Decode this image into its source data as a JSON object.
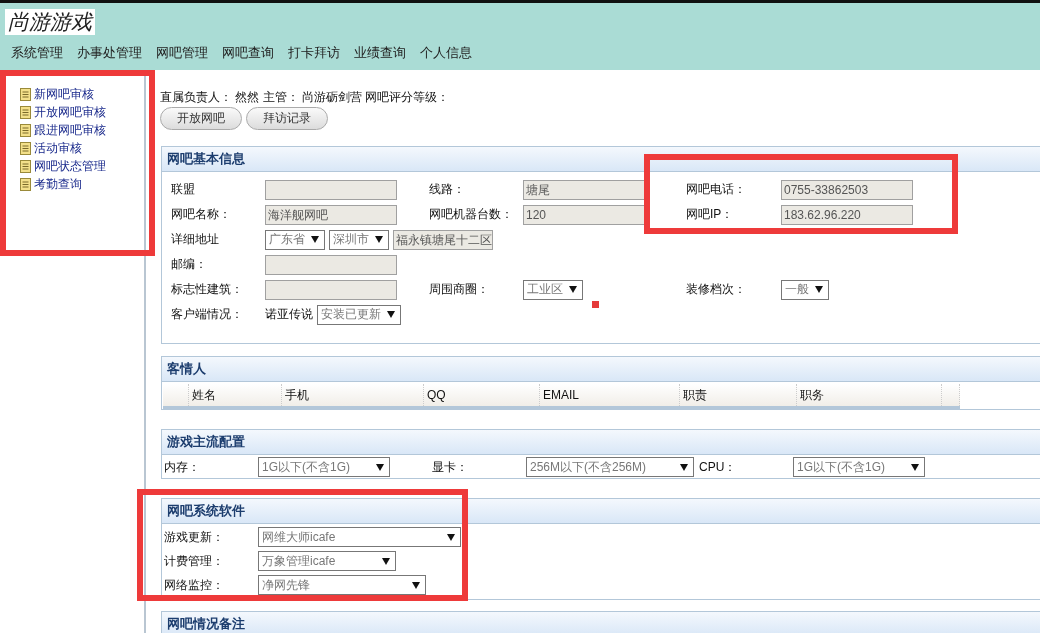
{
  "logo": "尚游游戏",
  "menu": [
    "系统管理",
    "办事处管理",
    "网吧管理",
    "网吧查询",
    "打卡拜访",
    "业绩查询",
    "个人信息"
  ],
  "sidebar": {
    "items": [
      "新网吧审核",
      "开放网吧审核",
      "跟进网吧审核",
      "活动审核",
      "网吧状态管理",
      "考勤查询"
    ]
  },
  "summary": "直属负责人： 然然 主管： 尚游砺剑营 网吧评分等级：",
  "buttons": [
    "开放网吧",
    "拜访记录"
  ],
  "basic_info": {
    "title": "网吧基本信息",
    "rows": [
      {
        "kind": "plain",
        "cells": [
          {
            "label": "联盟",
            "controls": [
              {
                "kind": "input"
              }
            ]
          },
          {
            "label": "线路：",
            "controls": [
              {
                "kind": "input",
                "value": "塘尾"
              }
            ]
          },
          {
            "label": "网吧电话：",
            "controls": [
              {
                "kind": "input",
                "value": "0755-33862503"
              }
            ]
          }
        ]
      },
      {
        "kind": "plain",
        "cells": [
          {
            "label": "网吧名称：",
            "controls": [
              {
                "kind": "input",
                "value": "海洋舰网吧"
              }
            ]
          },
          {
            "label": "网吧机器台数：",
            "controls": [
              {
                "kind": "input",
                "value": "120"
              }
            ]
          },
          {
            "label": "网吧IP：",
            "controls": [
              {
                "kind": "input",
                "value": "183.62.96.220"
              }
            ]
          }
        ]
      },
      {
        "kind": "address",
        "cells": [
          {
            "label": "详细地址",
            "controls": [
              {
                "kind": "select",
                "value": "广东省"
              },
              {
                "kind": "select",
                "value": "深圳市"
              },
              {
                "kind": "input",
                "value": "福永镇塘尾十二区"
              }
            ]
          }
        ]
      },
      {
        "kind": "plain",
        "cells": [
          {
            "label": "邮编：",
            "controls": [
              {
                "kind": "input"
              }
            ]
          }
        ]
      },
      {
        "kind": "plain",
        "cells": [
          {
            "label": "标志性建筑：",
            "controls": [
              {
                "kind": "input"
              }
            ]
          },
          {
            "label": "周围商圈：",
            "controls": [
              {
                "kind": "select",
                "value": "工业区"
              }
            ]
          },
          {
            "label": "装修档次：",
            "controls": [
              {
                "kind": "select",
                "value": "一般"
              }
            ]
          }
        ]
      },
      {
        "kind": "plain",
        "cells": [
          {
            "label": "客户端情况：",
            "controls": [
              {
                "kind": "text",
                "value": "诺亚传说"
              },
              {
                "kind": "select",
                "value": "安装已更新"
              }
            ]
          }
        ]
      }
    ]
  },
  "contacts": {
    "title": "客情人",
    "columns": [
      "姓名",
      "手机",
      "QQ",
      "EMAIL",
      "职责",
      "职务"
    ]
  },
  "game_config": {
    "title": "游戏主流配置",
    "fields": [
      {
        "label": "内存：",
        "value": "1G以下(不含1G)"
      },
      {
        "label": "显卡：",
        "value": "256M以下(不含256M)"
      },
      {
        "label": "CPU：",
        "value": "1G以下(不含1G)"
      }
    ]
  },
  "software": {
    "title": "网吧系统软件",
    "fields": [
      {
        "label": "游戏更新：",
        "value": "网维大师icafe"
      },
      {
        "label": "计费管理：",
        "value": "万象管理icafe"
      },
      {
        "label": "网络监控：",
        "value": "净网先锋"
      }
    ]
  },
  "notes": {
    "title": "网吧情况备注"
  }
}
